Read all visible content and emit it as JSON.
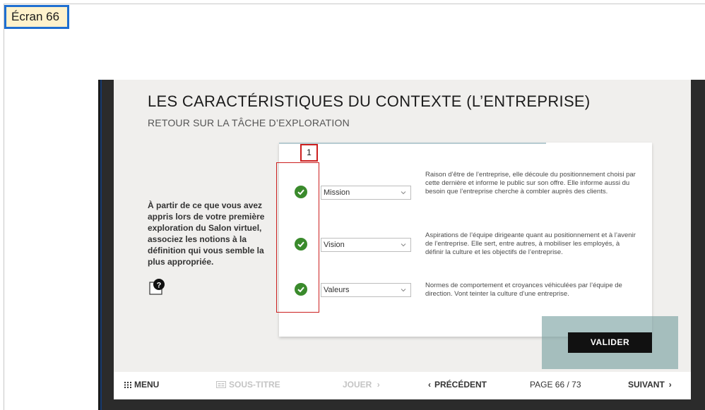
{
  "screen_label": "Écran 66",
  "slide": {
    "title": "LES CARACTÉRISTIQUES DU CONTEXTE (L’ENTREPRISE)",
    "subtitle": "RETOUR SUR LA TÂCHE D’EXPLORATION",
    "instructions": "À partir de ce que vous avez appris lors de votre première exploration du Salon virtuel, associez les notions à la définition qui vous semble la plus appropriée.",
    "help_icon": "question-mark-icon",
    "rows": [
      {
        "selected": "Mission",
        "definition": "Raison d’être de l’entreprise, elle découle du positionnement choisi par cette dernière et informe le public sur son offre. Elle informe aussi du besoin que l’entreprise cherche à combler auprès des clients."
      },
      {
        "selected": "Vision",
        "definition": "Aspirations de l’équipe dirigeante quant au positionnement et à l’avenir de l’entreprise. Elle sert, entre autres, à mobiliser les employés, à définir la culture et les objectifs de l’entreprise."
      },
      {
        "selected": "Valeurs",
        "definition": "Normes de comportement et croyances véhiculées par l’équipe de direction. Vont teinter la culture d’une entreprise."
      }
    ],
    "valider_label": "VALIDER"
  },
  "annotation": {
    "marker_number": "1"
  },
  "navbar": {
    "menu": "MENU",
    "subtitles": "SOUS-TITRE",
    "play": "JOUER",
    "previous": "PRÉCÉDENT",
    "page": "PAGE 66 / 73",
    "next": "SUIVANT"
  },
  "colors": {
    "check_green": "#3a8a2c",
    "annotation_red": "#cc1f1f",
    "label_border_blue": "#1f6fd1",
    "label_bg": "#fff2cc"
  }
}
